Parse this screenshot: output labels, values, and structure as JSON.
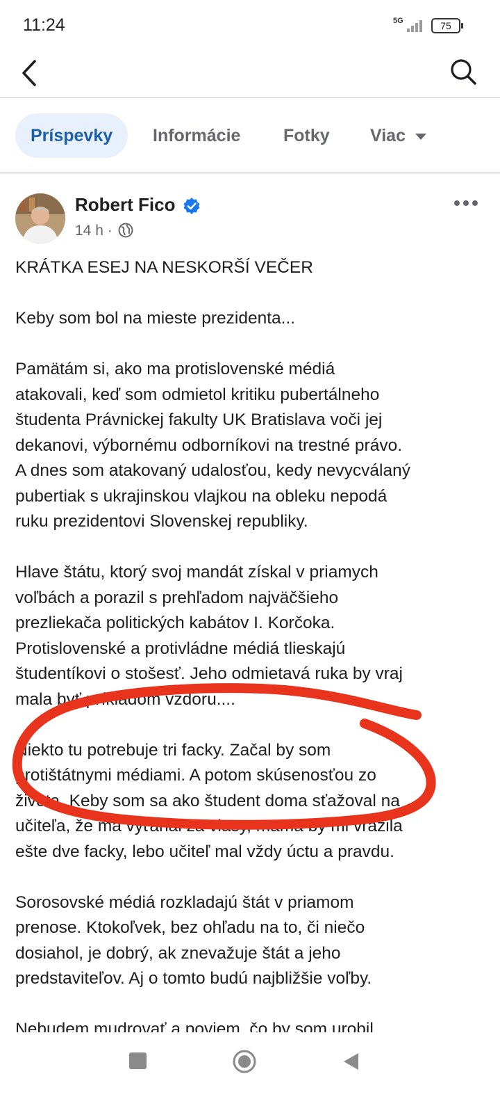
{
  "status_bar": {
    "time": "11:24",
    "network": "5G",
    "battery": "75"
  },
  "tabs": [
    {
      "label": "Príspevky"
    },
    {
      "label": "Informácie"
    },
    {
      "label": "Fotky"
    },
    {
      "label": "Viac"
    }
  ],
  "post": {
    "author": "Robert Fico",
    "time": "14 h",
    "separator": "·",
    "paragraphs": [
      "KRÁTKA ESEJ NA NESKORŠÍ VEČER",
      "Keby som bol na mieste prezidenta...",
      "Pamätám si, ako ma protislovenské médiá\natakovali, keď som odmietol kritiku pubertálneho\nštudenta Právnickej fakulty UK Bratislava voči jej\ndekanovi, výbornému odborníkovi na trestné právo.\nA dnes som atakovaný udalosťou, kedy nevycválaný\npubertiak s ukrajinskou vlajkou na obleku nepodá\nruku prezidentovi Slovenskej republiky.",
      "Hlave štátu, ktorý svoj mandát získal v priamych\nvoľbách a porazil s prehľadom najväčšieho\nprezliekača politických kabátov I. Korčoka.\nProtislovenské a protivládne médiá tlieskajú\nštudentíkovi o stošesť. Jeho odmietavá ruka by vraj\nmala byť príkladom vzdoru....",
      "Niekto tu potrebuje tri facky. Začal by som\nprotištátnymi médiami. A potom skúsenosťou zo\nživota. Keby som sa ako študent doma sťažoval na\nučiteľa, že ma vyťahal za vlasy, mama by mi vrazila\nešte dve facky, lebo učiteľ mal vždy úctu a pravdu.",
      "Sorosovské médiá rozkladajú štát v priamom\nprenose. Ktokoľvek, bez ohľadu na to, či niečo\ndosiahol, je dobrý, ak znevažuje štát a jeho\npredstaviteľov. Aj o tomto budú najbližšie voľby.",
      "Nebudem mudrovať a poviem, čo by som urobil"
    ]
  },
  "colors": {
    "accent": "#1d5fa8",
    "active_tab_bg": "#e7f0fb",
    "verified": "#1877f2",
    "annotation": "#e8341c",
    "muted": "#65676b"
  },
  "icons": {
    "back": "back-arrow-icon",
    "search": "search-icon",
    "verified": "verified-badge-icon",
    "globe": "globe-icon",
    "more": "more-options-icon",
    "dropdown": "caret-down-icon"
  }
}
